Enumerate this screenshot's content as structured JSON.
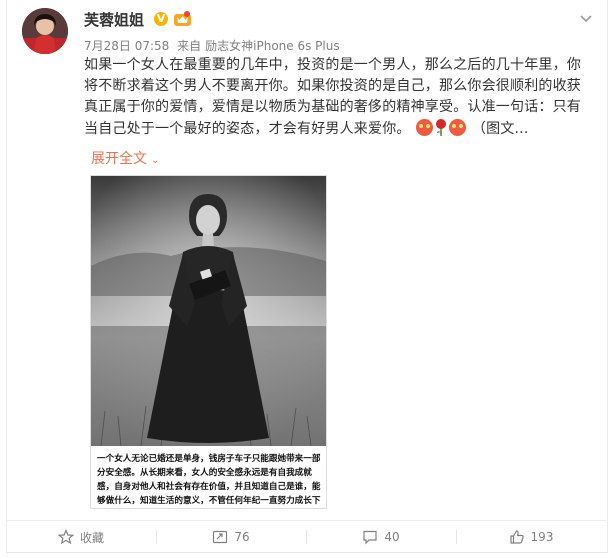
{
  "post": {
    "username": "芙蓉姐姐",
    "verified_badge": "V",
    "meta": {
      "date": "7月28日 07:58",
      "source_prefix": "来自",
      "source": "励志女神iPhone 6s Plus"
    },
    "text_parts": [
      "如果一个女人在最重要的几年中，投资的是一个男人，那么之后的几十年里，你将不断求着这个男人不要离开你。如果你投资的是自己，那么你会很顺利的收获真正属于你的爱情，爱情是以物质为基础的奢侈的精神享受。认准一句话：只有当自己处于一个最好的姿态，才会有好男人来爱你。",
      "（图文..."
    ],
    "emoji_icons": [
      "heart-eyes-emoji",
      "rose-emoji",
      "heart-eyes-emoji"
    ],
    "expand_label": "展开全文",
    "image_caption": "一个女人无论已婚还是单身，钱房子车子只能跟她带来一部分安全感。从长期来看，女人的安全感永远是有自我成就感，自身对他人和社会有存在价值，并且知道自己是谁，能够做什么，知道生活的意义，不管任何年纪一直努力成长下"
  },
  "actions": {
    "favorite_label": "收藏",
    "repost_count": "76",
    "comment_count": "40",
    "like_count": "193"
  },
  "colors": {
    "accent": "#eb7350",
    "verified": "#f7b500",
    "meta_text": "#808080"
  }
}
